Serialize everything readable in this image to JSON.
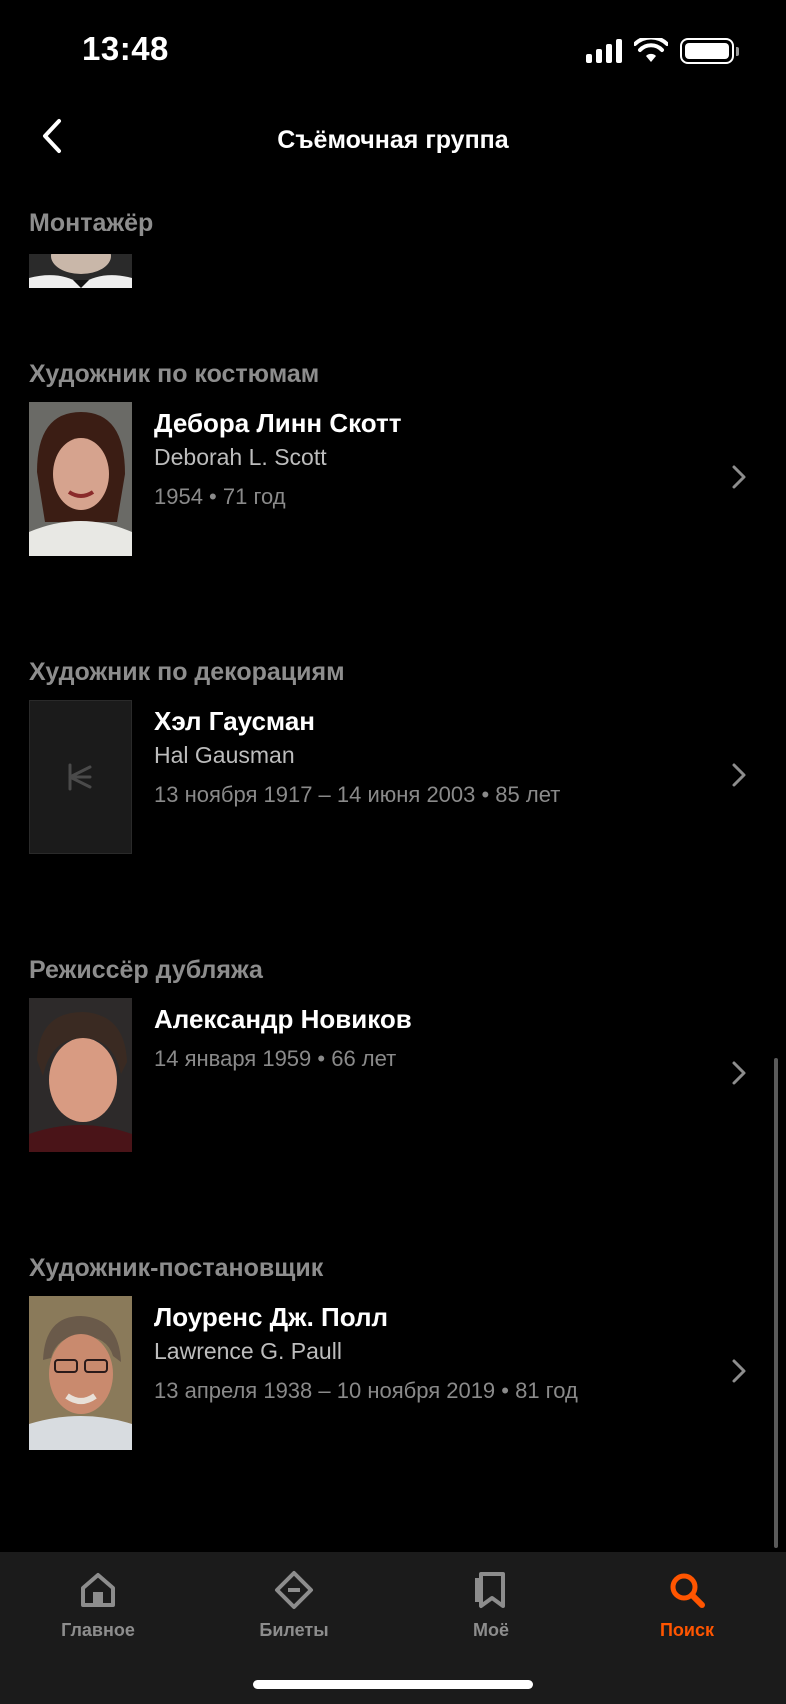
{
  "status_bar": {
    "time": "13:48"
  },
  "nav": {
    "title": "Съёмочная группа"
  },
  "sections": [
    {
      "title": "Монтажёр",
      "people": []
    },
    {
      "title": "Художник по костюмам",
      "people": [
        {
          "name": "Дебора Линн Скотт",
          "original": "Deborah L. Scott",
          "meta": "1954  •  71 год"
        }
      ]
    },
    {
      "title": "Художник по декорациям",
      "people": [
        {
          "name": "Хэл Гаусман",
          "original": "Hal Gausman",
          "meta": "13 ноября 1917 – 14 июня 2003  •  85 лет"
        }
      ]
    },
    {
      "title": "Режиссёр дубляжа",
      "people": [
        {
          "name": "Александр Новиков",
          "original": "",
          "meta": "14 января 1959  •  66 лет"
        }
      ]
    },
    {
      "title": "Художник-постановщик",
      "people": [
        {
          "name": "Лоуренс Дж. Полл",
          "original": "Lawrence G. Paull",
          "meta": "13 апреля 1938 – 10 ноября 2019  •  81 год"
        }
      ]
    }
  ],
  "tabs": [
    {
      "label": "Главное",
      "icon": "home-icon",
      "active": false
    },
    {
      "label": "Билеты",
      "icon": "ticket-icon",
      "active": false
    },
    {
      "label": "Моё",
      "icon": "bookmark-icon",
      "active": false
    },
    {
      "label": "Поиск",
      "icon": "search-icon",
      "active": true
    }
  ],
  "colors": {
    "accent": "#ff5500",
    "background": "#000000",
    "tab_bar": "#1b1b1b",
    "muted": "#8d8d8d"
  }
}
